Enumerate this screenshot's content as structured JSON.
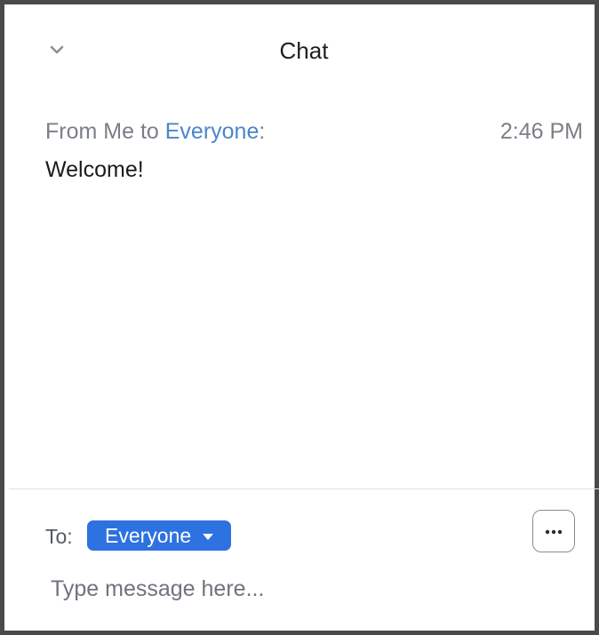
{
  "header": {
    "title": "Chat",
    "collapse_icon": "chevron-down-icon"
  },
  "messages": [
    {
      "from_prefix": "From Me to ",
      "recipient": "Everyone",
      "suffix": ":",
      "time": "2:46 PM",
      "text": "Welcome!"
    }
  ],
  "composer": {
    "to_label": "To:",
    "recipient": "Everyone",
    "more_icon": "more-options-icon",
    "placeholder": "Type message here..."
  },
  "colors": {
    "accent": "#2d72e0",
    "recipient_link": "#4a86c8",
    "meta_text": "#7b7f87",
    "border": "#4a4a4a"
  }
}
